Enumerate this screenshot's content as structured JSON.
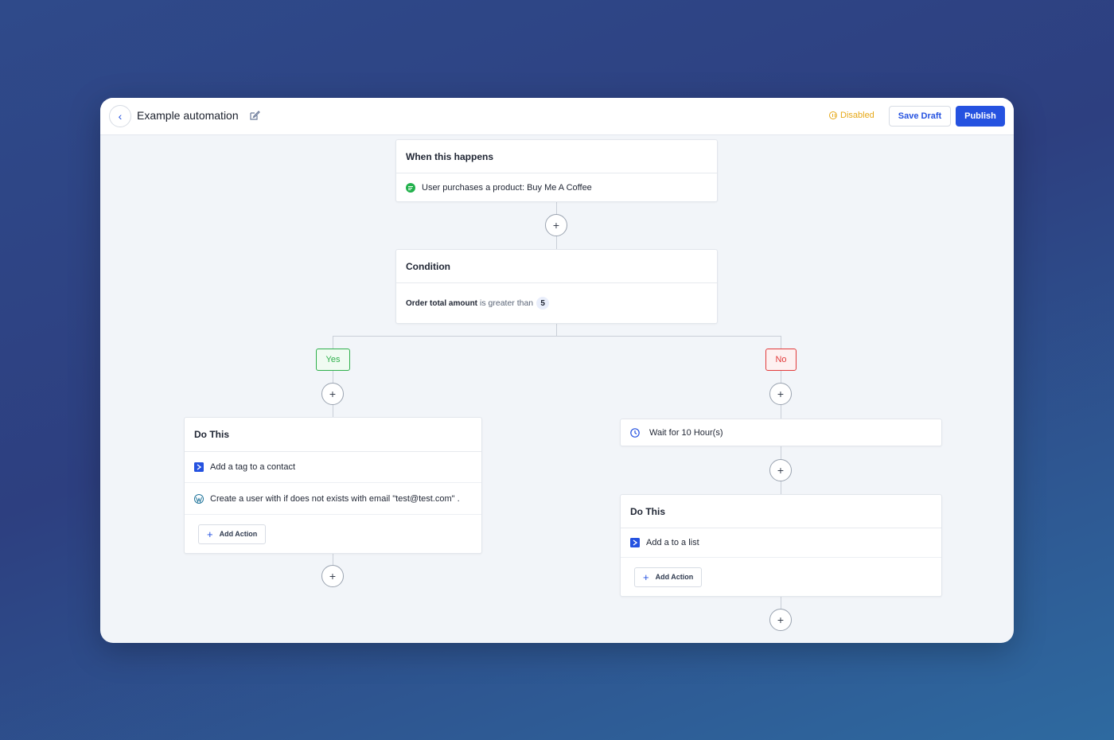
{
  "header": {
    "title": "Example automation",
    "status": "Disabled",
    "save_draft": "Save Draft",
    "publish": "Publish"
  },
  "trigger": {
    "heading": "When this happens",
    "event": "User purchases a product: Buy Me A Coffee"
  },
  "condition": {
    "heading": "Condition",
    "field": "Order total amount",
    "operator": "is greater than",
    "value": "5"
  },
  "branches": {
    "yes_label": "Yes",
    "no_label": "No"
  },
  "yes_branch": {
    "heading": "Do This",
    "actions": [
      {
        "label": "Add a tag to a contact",
        "icon": "fluentcrm-icon"
      },
      {
        "label": "Create a user with if does not exists with email \"test@test.com\" .",
        "icon": "wordpress-icon"
      }
    ],
    "add_action": "Add Action"
  },
  "no_branch": {
    "wait": "Wait for 10 Hour(s)",
    "heading": "Do This",
    "actions": [
      {
        "label": "Add a to a list",
        "icon": "fluentcrm-icon"
      }
    ],
    "add_action": "Add Action"
  },
  "colors": {
    "accent": "#2552e0",
    "disabled": "#e6a817",
    "yes": "#2fb04c",
    "no": "#e23b3b"
  }
}
